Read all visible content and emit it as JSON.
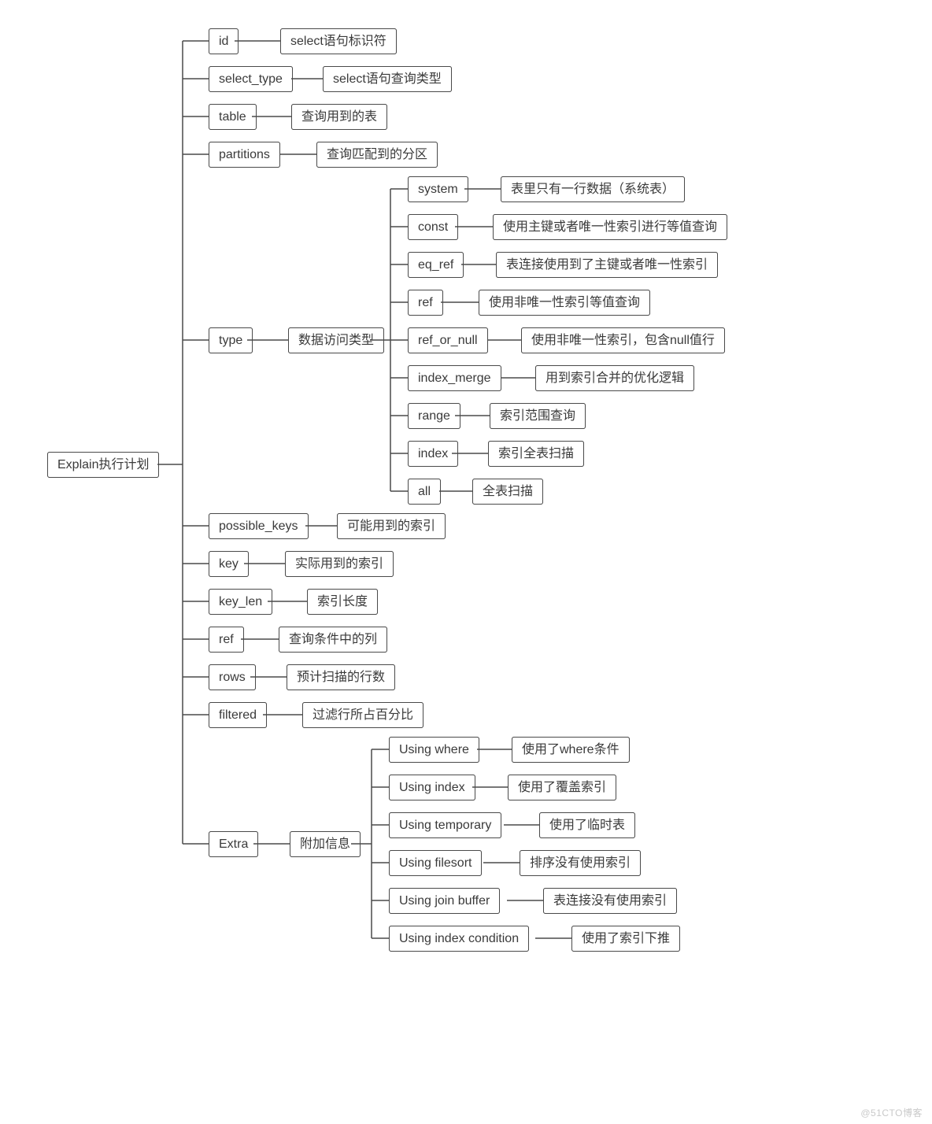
{
  "root": "Explain执行计划",
  "children": [
    {
      "name": "id",
      "desc": "select语句标识符"
    },
    {
      "name": "select_type",
      "desc": "select语句查询类型"
    },
    {
      "name": "table",
      "desc": "查询用到的表"
    },
    {
      "name": "partitions",
      "desc": "查询匹配到的分区"
    },
    {
      "name": "type",
      "desc": "数据访问类型",
      "children": [
        {
          "name": "system",
          "desc": "表里只有一行数据（系统表）"
        },
        {
          "name": "const",
          "desc": "使用主键或者唯一性索引进行等值查询"
        },
        {
          "name": "eq_ref",
          "desc": "表连接使用到了主键或者唯一性索引"
        },
        {
          "name": "ref",
          "desc": "使用非唯一性索引等值查询"
        },
        {
          "name": "ref_or_null",
          "desc": "使用非唯一性索引，包含null值行"
        },
        {
          "name": "index_merge",
          "desc": "用到索引合并的优化逻辑"
        },
        {
          "name": "range",
          "desc": "索引范围查询"
        },
        {
          "name": "index",
          "desc": "索引全表扫描"
        },
        {
          "name": "all",
          "desc": "全表扫描"
        }
      ]
    },
    {
      "name": "possible_keys",
      "desc": "可能用到的索引"
    },
    {
      "name": "key",
      "desc": "实际用到的索引"
    },
    {
      "name": "key_len",
      "desc": "索引长度"
    },
    {
      "name": "ref",
      "desc": "查询条件中的列"
    },
    {
      "name": "rows",
      "desc": "预计扫描的行数"
    },
    {
      "name": "filtered",
      "desc": "过滤行所占百分比"
    },
    {
      "name": "Extra",
      "desc": "附加信息",
      "children": [
        {
          "name": "Using where",
          "desc": "使用了where条件"
        },
        {
          "name": "Using index",
          "desc": "使用了覆盖索引"
        },
        {
          "name": "Using temporary",
          "desc": "使用了临时表"
        },
        {
          "name": "Using filesort",
          "desc": "排序没有使用索引"
        },
        {
          "name": "Using join buffer",
          "desc": "表连接没有使用索引"
        },
        {
          "name": "Using index condition",
          "desc": "使用了索引下推"
        }
      ]
    }
  ],
  "watermark": "@51CTO博客"
}
